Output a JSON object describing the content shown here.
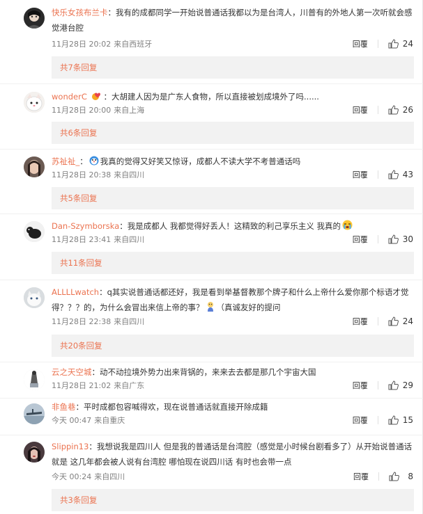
{
  "comments": [
    {
      "user": "快乐女孩布兰卡",
      "text": "我有的成都同学一开始说普通话我都以为是台湾人，川普有的外地人第一次听就会感觉港台腔",
      "time": "11月28日 20:02",
      "location": "来自西班牙",
      "reply_label": "回覆",
      "likes": "24",
      "more_label": "共7条回复"
    },
    {
      "user": "wonderC",
      "text": "大胡建人因为是广东人食物，所以直接被划成境外了吗......",
      "time": "11月28日 20:00",
      "location": "来自上海",
      "reply_label": "回覆",
      "likes": "26",
      "more_label": "共6条回复"
    },
    {
      "user": "苏祉祉_",
      "text": "我真的觉得又好笑又惊讶，成都人不读大学不考普通话吗",
      "time": "11月28日 20:38",
      "location": "来自四川",
      "reply_label": "回覆",
      "likes": "43",
      "more_label": "共5条回复"
    },
    {
      "user": "Dan-Szymborska",
      "text": "我是成都人 我都觉得好丢人！这精致的利己享乐主义 我真的",
      "time": "11月28日 23:41",
      "location": "来自四川",
      "reply_label": "回覆",
      "likes": "30",
      "more_label": "共11条回复"
    },
    {
      "user": "ALLLLwatch",
      "text": "q其实说普通话都还好，我是看到举基督教那个牌子和什么上帝什么爱你那个标语才觉得？？？的，为什么会冒出来信上帝的事？",
      "text2": "（真诚友好的提问",
      "time": "11月28日 22:38",
      "location": "来自四川",
      "reply_label": "回覆",
      "likes": "24",
      "more_label": "共20条回复"
    },
    {
      "user": "云之天空城",
      "text": "动不动拉境外势力出来背锅的，来来去去都是那几个宇宙大国",
      "time": "11月28日 21:02",
      "location": "来自广东",
      "reply_label": "回覆",
      "likes": "29"
    },
    {
      "user": "非鱼巷",
      "text": "平时成都包容喊得欢，现在说普通话就直接开除成籍",
      "time": "今天 00:47",
      "location": "来自重庆",
      "reply_label": "回覆",
      "likes": "15"
    },
    {
      "user": "Slippin13",
      "text": "我想说我是四川人 但是我的普通话是台湾腔（感觉是小时候台剧看多了）从开始说普通话就是 这几年都会被人说有台湾腔 哪怕现在说四川话 有时也会带一点",
      "time": "今天 00:24",
      "location": "来自四川",
      "reply_label": "回覆",
      "likes": "8",
      "more_label": "共3条回复"
    }
  ],
  "colors": {
    "username": "#eb7350",
    "meta": "#808080",
    "more_bg": "#f2f2f2"
  },
  "icons": [
    "thumb-up-icon",
    "heart-badge-icon",
    "laugh-emoji-icon",
    "cry-emoji-icon",
    "thinking-emoji-icon"
  ]
}
